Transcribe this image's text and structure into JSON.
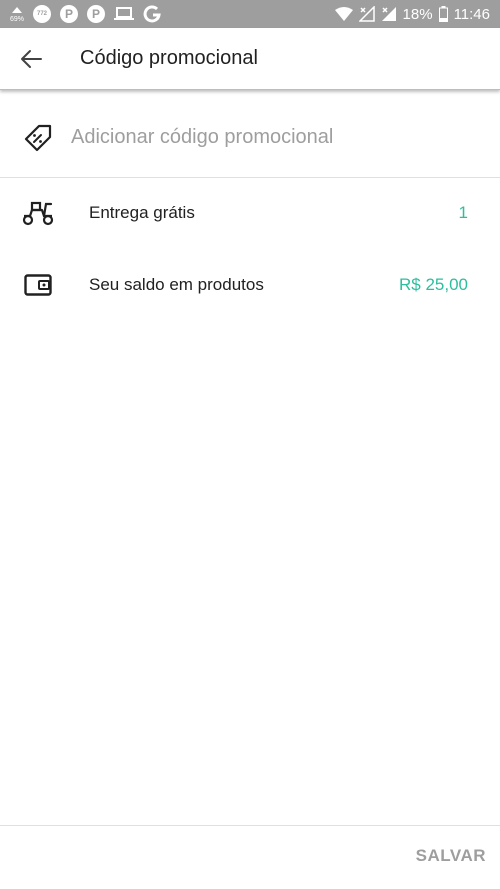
{
  "status_bar": {
    "left_small_text": "69%",
    "left_badge_text": "772",
    "battery_percent": "18%",
    "time": "11:46"
  },
  "header": {
    "title": "Código promocional"
  },
  "promo": {
    "placeholder": "Adicionar código promocional"
  },
  "benefits": [
    {
      "label": "Entrega grátis",
      "value": "1",
      "icon": "scooter-icon"
    },
    {
      "label": "Seu saldo em produtos",
      "value": "R$ 25,00",
      "icon": "wallet-icon"
    }
  ],
  "footer": {
    "save_label": "SALVAR"
  },
  "colors": {
    "accent": "#2bbf9e",
    "status_bar": "#9e9e9e",
    "disabled_text": "#9e9e9e"
  }
}
